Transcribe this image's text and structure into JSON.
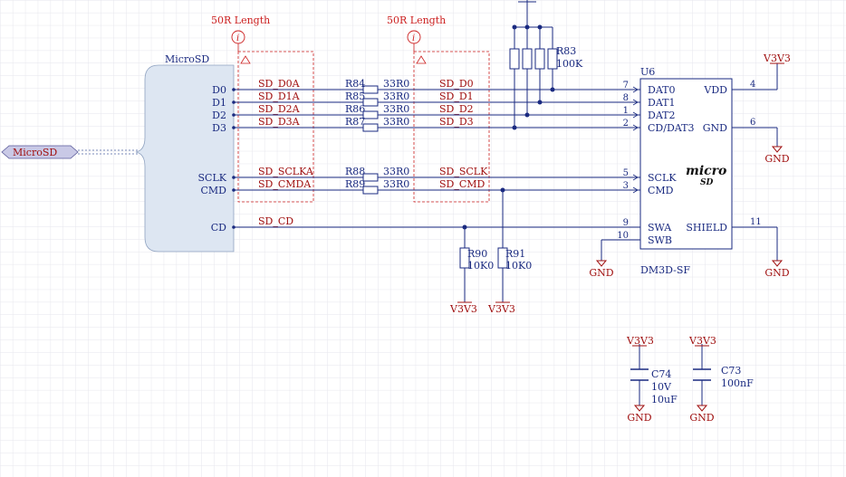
{
  "colors": {
    "grid": "#e8e8ec",
    "wire": "#1a2a80",
    "component": "#1a2a80",
    "label_red": "#a01010",
    "directive": "#cc2020",
    "harness": "#dbe4f0",
    "port_fill": "#c8c8e8"
  },
  "port": {
    "label": "MicroSD"
  },
  "harness": {
    "label": "MicroSD",
    "pins": [
      "D0",
      "D1",
      "D2",
      "D3",
      "SCLK",
      "CMD",
      "CD"
    ]
  },
  "directives": [
    {
      "label": "50R Length"
    },
    {
      "label": "50R Length"
    }
  ],
  "nets_left": [
    "SD_D0A",
    "SD_D1A",
    "SD_D2A",
    "SD_D3A",
    "SD_SCLKA",
    "SD_CMDA",
    "SD_CD"
  ],
  "nets_right": [
    "SD_D0",
    "SD_D1",
    "SD_D2",
    "SD_D3",
    "SD_SCLK",
    "SD_CMD"
  ],
  "series_resistors": [
    {
      "ref": "R84",
      "value": "33R0"
    },
    {
      "ref": "R85",
      "value": "33R0"
    },
    {
      "ref": "R86",
      "value": "33R0"
    },
    {
      "ref": "R87",
      "value": "33R0"
    },
    {
      "ref": "R88",
      "value": "33R0"
    },
    {
      "ref": "R89",
      "value": "33R0"
    }
  ],
  "pullup_array": {
    "ref": "R83",
    "value": "100K"
  },
  "pullups": [
    {
      "ref": "R90",
      "value": "10K0",
      "power": "V3V3"
    },
    {
      "ref": "R91",
      "value": "10K0",
      "power": "V3V3"
    }
  ],
  "connector": {
    "ref": "U6",
    "part": "DM3D-SF",
    "logo": "micro",
    "logo_sub": "SD",
    "left_pins": [
      {
        "name": "DAT0",
        "num": "7"
      },
      {
        "name": "DAT1",
        "num": "8"
      },
      {
        "name": "DAT2",
        "num": "1"
      },
      {
        "name": "CD/DAT3",
        "num": "2"
      },
      {
        "name": "SCLK",
        "num": "5"
      },
      {
        "name": "CMD",
        "num": "3"
      },
      {
        "name": "SWA",
        "num": "9"
      },
      {
        "name": "SWB",
        "num": "10"
      }
    ],
    "right_pins": [
      {
        "name": "VDD",
        "num": "4"
      },
      {
        "name": "GND",
        "num": "6"
      },
      {
        "name": "SHIELD",
        "num": "11"
      }
    ]
  },
  "power": {
    "v3v3": "V3V3",
    "gnd": "GND"
  },
  "capacitors": [
    {
      "ref": "C74",
      "voltage": "10V",
      "value": "10uF"
    },
    {
      "ref": "C73",
      "value": "100nF"
    }
  ]
}
